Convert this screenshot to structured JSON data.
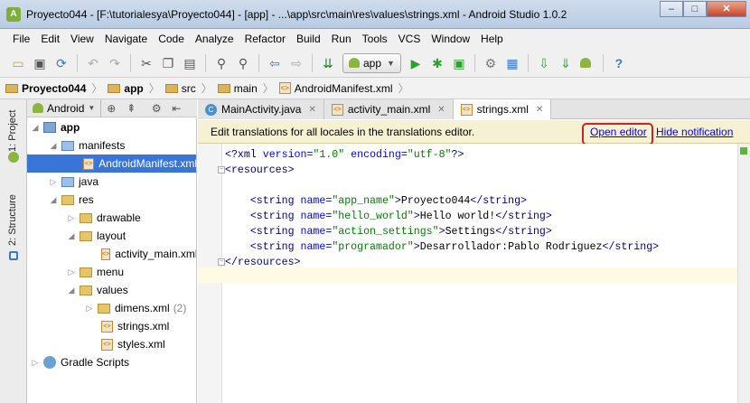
{
  "window": {
    "title": "Proyecto044 - [F:\\tutorialesya\\Proyecto044] - [app] - ...\\app\\src\\main\\res\\values\\strings.xml - Android Studio 1.0.2",
    "app_icon": "android-studio-icon",
    "controls": {
      "minimize": "–",
      "maximize": "□",
      "close": "✕"
    }
  },
  "menubar": {
    "items": [
      "File",
      "Edit",
      "View",
      "Navigate",
      "Code",
      "Analyze",
      "Refactor",
      "Build",
      "Run",
      "Tools",
      "VCS",
      "Window",
      "Help"
    ]
  },
  "toolbar": {
    "run_config": "app",
    "icons": [
      "open-icon",
      "save-icon",
      "sync-icon",
      "undo-icon",
      "redo-icon",
      "cut-icon",
      "copy-icon",
      "paste-icon",
      "find-icon",
      "replace-icon",
      "back-icon",
      "forward-icon",
      "make-icon",
      "run-config-icon",
      "run-icon",
      "debug-icon",
      "attach-icon",
      "project-structure-icon",
      "avd-manager-icon",
      "sdk-manager-icon",
      "monitor-icon",
      "android-icon",
      "help-icon"
    ]
  },
  "breadcrumb": {
    "items": [
      "Proyecto044",
      "app",
      "src",
      "main",
      "AndroidManifest.xml"
    ]
  },
  "side_tabs": {
    "project": "1: Project",
    "structure": "2: Structure"
  },
  "project_panel": {
    "view_mode": "Android",
    "tree": [
      {
        "label": "app",
        "bold": true
      },
      {
        "label": "manifests"
      },
      {
        "label": "AndroidManifest.xml",
        "selected": true
      },
      {
        "label": "java"
      },
      {
        "label": "res"
      },
      {
        "label": "drawable"
      },
      {
        "label": "layout"
      },
      {
        "label": "activity_main.xml"
      },
      {
        "label": "menu"
      },
      {
        "label": "values"
      },
      {
        "label": "dimens.xml",
        "count": "(2)"
      },
      {
        "label": "strings.xml"
      },
      {
        "label": "styles.xml"
      },
      {
        "label": "Gradle Scripts"
      }
    ]
  },
  "editor_tabs": [
    {
      "label": "MainActivity.java",
      "type": "java"
    },
    {
      "label": "activity_main.xml",
      "type": "xml"
    },
    {
      "label": "strings.xml",
      "type": "xml",
      "active": true
    }
  ],
  "notification": {
    "text": "Edit translations for all locales in the translations editor.",
    "open_editor": "Open editor",
    "hide": "Hide notification"
  },
  "code": {
    "xml_decl_open": "<?xml ",
    "version_attr": "version=",
    "version_val": "\"1.0\"",
    "encoding_attr": " encoding=",
    "encoding_val": "\"utf-8\"",
    "xml_decl_close": "?>",
    "resources_open": "<resources>",
    "resources_close": "</resources>",
    "string_open": "<string ",
    "string_close": "</string>",
    "name_attr": "name=",
    "strings": [
      {
        "name": "\"app_name\"",
        "value": "Proyecto044"
      },
      {
        "name": "\"hello_world\"",
        "value": "Hello world!"
      },
      {
        "name": "\"action_settings\"",
        "value": "Settings"
      },
      {
        "name": "\"programador\"",
        "value": "Desarrollador:Pablo Rodriguez"
      }
    ]
  }
}
